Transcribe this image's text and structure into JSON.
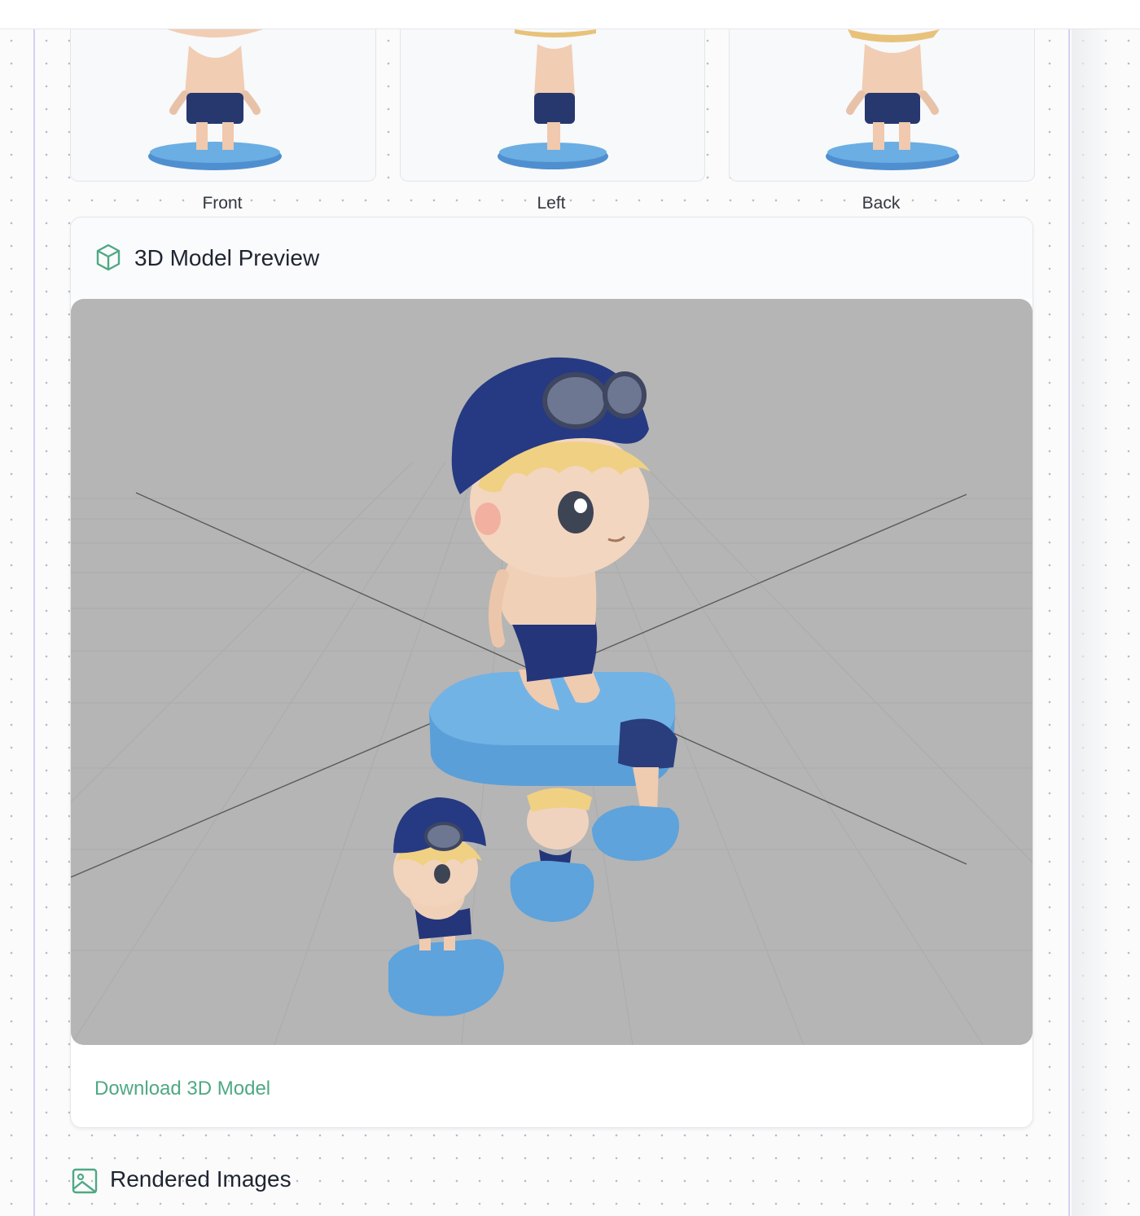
{
  "views": {
    "front_label": "Front",
    "left_label": "Left",
    "back_label": "Back"
  },
  "preview": {
    "title": "3D Model Preview",
    "title_icon": "cube-icon",
    "download_label": "Download 3D Model"
  },
  "rendered": {
    "title": "Rendered Images",
    "title_icon": "image-icon"
  },
  "colors": {
    "accent": "#4fa884",
    "panel_border": "#d5d0f2",
    "viewer_background": "#b5b5b5",
    "cap_navy": "#253a82",
    "base_blue": "#5fa3dc"
  }
}
